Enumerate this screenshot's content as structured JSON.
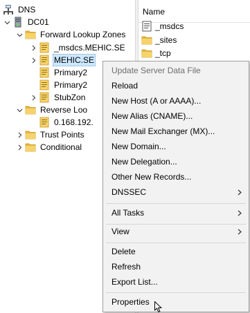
{
  "tree": {
    "root": "DNS",
    "server": "DC01",
    "forward_zones": "Forward Lookup Zones",
    "zones": [
      "_msdcs.MEHIC.SE",
      "MEHIC.SE",
      "Primary2",
      "Primary2",
      "StubZon"
    ],
    "reverse_zones": "Reverse Loo",
    "reverse_child": "0.168.192.",
    "trust_points": "Trust Points",
    "conditional": "Conditional"
  },
  "list": {
    "header": "Name",
    "items": [
      "_msdcs",
      "_sites",
      "_tcp"
    ]
  },
  "menu": {
    "update": "Update Server Data File",
    "reload": "Reload",
    "new_host": "New Host (A or AAAA)...",
    "new_alias": "New Alias (CNAME)...",
    "new_mx": "New Mail Exchanger (MX)...",
    "new_domain": "New Domain...",
    "new_delegation": "New Delegation...",
    "other_records": "Other New Records...",
    "dnssec": "DNSSEC",
    "all_tasks": "All Tasks",
    "view": "View",
    "delete": "Delete",
    "refresh": "Refresh",
    "export": "Export List...",
    "properties": "Properties"
  }
}
